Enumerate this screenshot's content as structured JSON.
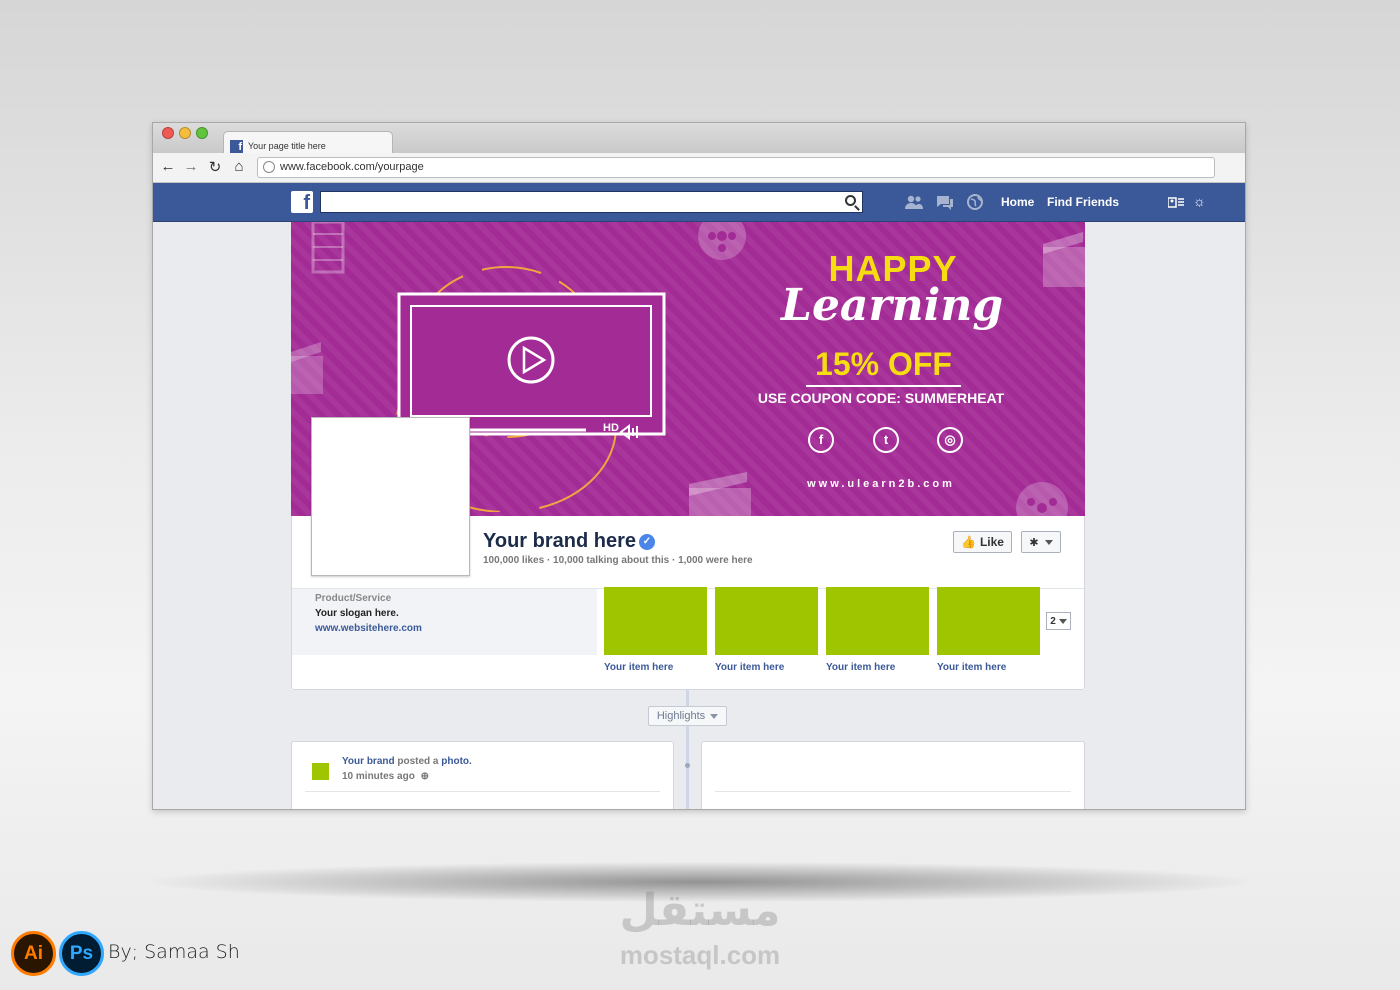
{
  "browser": {
    "tab_title": "Your page title here",
    "url": "www.facebook.com/yourpage"
  },
  "fb_nav": {
    "logo": "f",
    "home_label": "Home",
    "find_friends_label": "Find Friends"
  },
  "cover": {
    "headline_1": "HAPPY",
    "headline_2": "Learning",
    "offer": "15%  OFF",
    "coupon": "USE COUPON CODE: SUMMERHEAT",
    "website": "www.ulearn2b.com",
    "social_icons": [
      "facebook-icon",
      "twitter-icon",
      "instagram-icon"
    ],
    "player_hd_label": "HD"
  },
  "page": {
    "brand_name": "Your brand here",
    "stats": "100,000 likes · 10,000 talking about this · 1,000 were here",
    "like_label": "Like",
    "category": "Product/Service",
    "slogan": "Your slogan here.",
    "website": "www.websitehere.com",
    "apps": [
      {
        "label": "Your item here"
      },
      {
        "label": "Your item here"
      },
      {
        "label": "Your item here"
      },
      {
        "label": "Your item here"
      }
    ],
    "more_count": "2",
    "highlights_label": "Highlights"
  },
  "post": {
    "author": "Your brand",
    "action": " posted a ",
    "object": "photo.",
    "time": "10 minutes ago"
  },
  "footer": {
    "ai_badge": "Ai",
    "ps_badge": "Ps",
    "credit": "By; Samaa Sh",
    "watermark_ar": "مستقل",
    "watermark_en": "mostaql.com"
  },
  "colors": {
    "facebook_blue": "#3b5998",
    "cover_purple": "#a32b96",
    "accent_yellow": "#f5dd12",
    "app_green": "#9fc400"
  }
}
